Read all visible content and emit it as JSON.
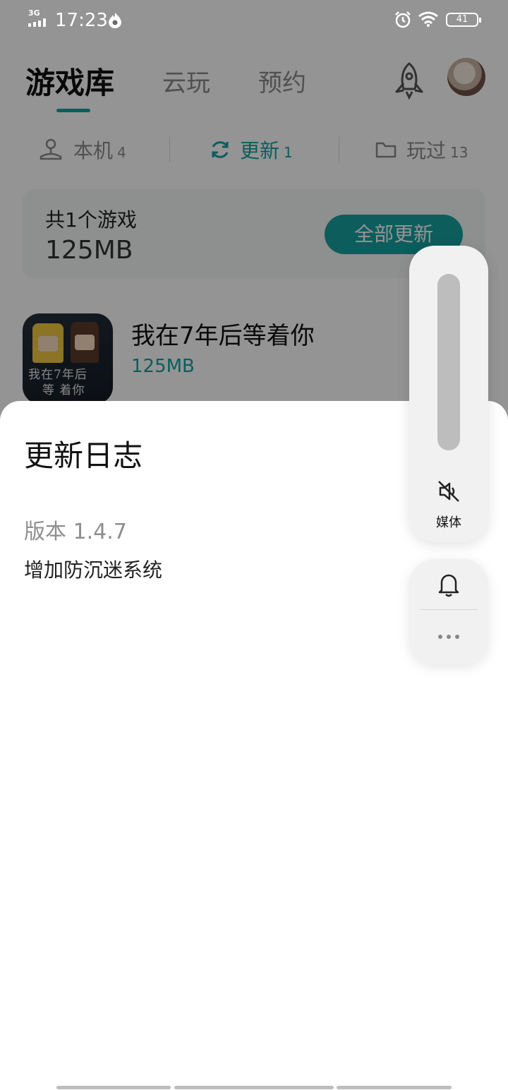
{
  "status_bar": {
    "network": "3G",
    "time": "17:23",
    "battery": "41"
  },
  "header": {
    "tabs": [
      {
        "label": "游戏库",
        "active": true
      },
      {
        "label": "云玩",
        "active": false
      },
      {
        "label": "预约",
        "active": false
      }
    ],
    "icons": [
      "rocket-icon",
      "avatar"
    ]
  },
  "filters": [
    {
      "label": "本机",
      "count": "4",
      "icon": "joystick-icon",
      "active": false
    },
    {
      "label": "更新",
      "count": "1",
      "icon": "refresh-icon",
      "active": true
    },
    {
      "label": "玩过",
      "count": "13",
      "icon": "folder-icon",
      "active": false
    }
  ],
  "summary": {
    "count_text": "共1个游戏",
    "total_size": "125MB",
    "update_all_label": "全部更新"
  },
  "games": [
    {
      "name": "我在7年后等着你",
      "size": "125MB",
      "icon_text_line1": "我在7年后",
      "icon_text_line2": "等 着你"
    }
  ],
  "sheet": {
    "title": "更新日志",
    "version": "版本 1.4.7",
    "changelog": "增加防沉迷系统"
  },
  "volume": {
    "media_label": "媒体",
    "level": 0
  },
  "colors": {
    "accent": "#17a0a0",
    "scrim": "rgba(0,0,0,0.42)",
    "panel": "#f1f1f1"
  }
}
